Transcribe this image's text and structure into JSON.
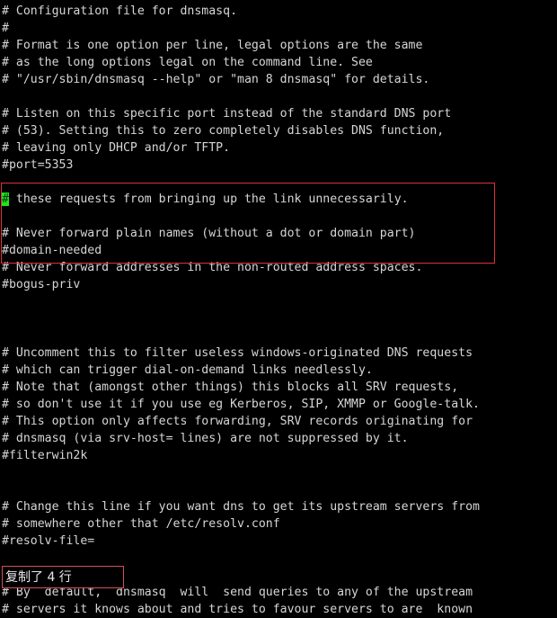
{
  "terminal": {
    "background_color": "#000000",
    "text_color": "#d6d6d6",
    "cursor_color": "#1ee61e",
    "selection_border_color": "#e0303a",
    "status_border_color": "#d1505a"
  },
  "cursor": {
    "character": "#",
    "line_index": 11,
    "column": 0
  },
  "lines": [
    "# Configuration file for dnsmasq.",
    "#",
    "# Format is one option per line, legal options are the same",
    "# as the long options legal on the command line. See",
    "# \"/usr/sbin/dnsmasq --help\" or \"man 8 dnsmasq\" for details.",
    "",
    "# Listen on this specific port instead of the standard DNS port",
    "# (53). Setting this to zero completely disables DNS function,",
    "# leaving only DHCP and/or TFTP.",
    "#port=5353",
    "",
    "# these requests from bringing up the link unnecessarily.",
    "",
    "# Never forward plain names (without a dot or domain part)",
    "#domain-needed",
    "# Never forward addresses in the non-routed address spaces.",
    "#bogus-priv",
    "",
    "",
    "",
    "# Uncomment this to filter useless windows-originated DNS requests",
    "# which can trigger dial-on-demand links needlessly.",
    "# Note that (amongst other things) this blocks all SRV requests,",
    "# so don't use it if you use eg Kerberos, SIP, XMMP or Google-talk.",
    "# This option only affects forwarding, SRV records originating for",
    "# dnsmasq (via srv-host= lines) are not suppressed by it.",
    "#filterwin2k",
    "",
    "",
    "# Change this line if you want dns to get its upstream servers from",
    "# somewhere other that /etc/resolv.conf",
    "#resolv-file=",
    "",
    "",
    "# By  default,  dnsmasq  will  send queries to any of the upstream",
    "# servers it knows about and tries to favour servers to are  known"
  ],
  "selection": {
    "highlighted_line_indices": [
      11,
      12,
      13,
      14
    ],
    "line_count": 4
  },
  "status": {
    "message": "复制了 4 行"
  }
}
